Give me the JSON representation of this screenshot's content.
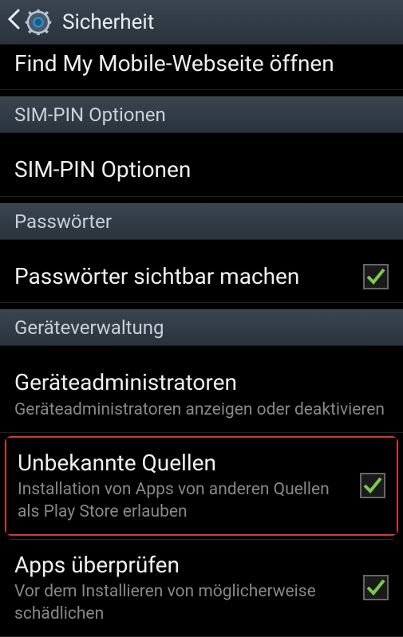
{
  "header": {
    "title": "Sicherheit"
  },
  "items": {
    "findMyMobile": {
      "title": "Find My Mobile-Webseite öffnen"
    },
    "simPinOptions": {
      "title": "SIM-PIN Optionen"
    },
    "passwordsVisible": {
      "title": "Passwörter sichtbar machen",
      "checked": true
    },
    "deviceAdmins": {
      "title": "Geräteadministratoren",
      "subtitle": "Geräteadministratoren anzeigen oder deaktivieren"
    },
    "unknownSources": {
      "title": "Unbekannte Quellen",
      "subtitle": "Installation von Apps von anderen Quellen als Play Store erlauben",
      "checked": true
    },
    "verifyApps": {
      "title": "Apps überprüfen",
      "subtitle": "Vor dem Installieren von möglicherweise schädlichen",
      "checked": true
    }
  },
  "sections": {
    "simPin": "SIM-PIN Optionen",
    "passwords": "Passwörter",
    "deviceMgmt": "Geräteverwaltung"
  }
}
